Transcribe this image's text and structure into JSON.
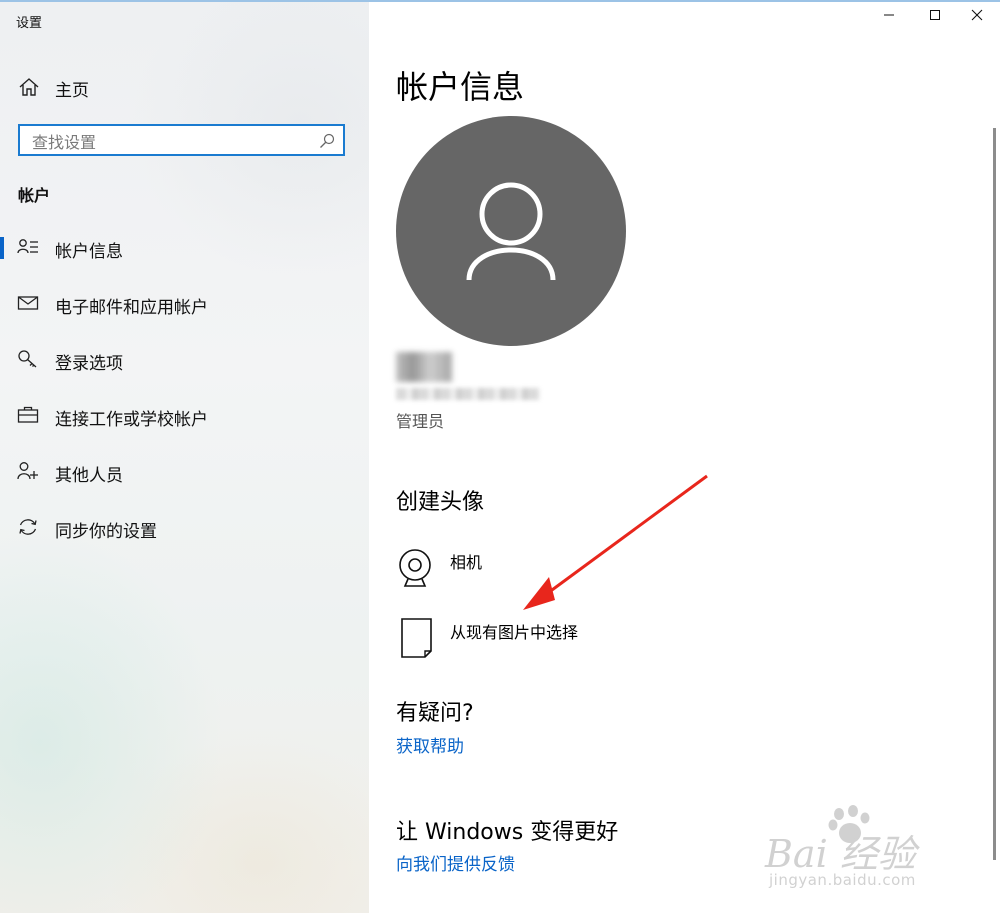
{
  "window": {
    "title": "设置",
    "controls": [
      "minimize",
      "maximize",
      "close"
    ]
  },
  "sidebar": {
    "home_label": "主页",
    "search_placeholder": "查找设置",
    "section_heading": "帐户",
    "items": [
      {
        "label": "帐户信息",
        "icon": "account-info-icon",
        "selected": true
      },
      {
        "label": "电子邮件和应用帐户",
        "icon": "mail-icon",
        "selected": false
      },
      {
        "label": "登录选项",
        "icon": "key-icon",
        "selected": false
      },
      {
        "label": "连接工作或学校帐户",
        "icon": "briefcase-icon",
        "selected": false
      },
      {
        "label": "其他人员",
        "icon": "add-person-icon",
        "selected": false
      },
      {
        "label": "同步你的设置",
        "icon": "sync-icon",
        "selected": false
      }
    ]
  },
  "main": {
    "title": "帐户信息",
    "role": "管理员",
    "create_avatar": {
      "heading": "创建头像",
      "options": [
        {
          "label": "相机",
          "icon": "webcam-icon"
        },
        {
          "label": "从现有图片中选择",
          "icon": "browse-picture-icon"
        }
      ]
    },
    "questions": {
      "heading": "有疑问?",
      "link": "获取帮助"
    },
    "feedback": {
      "heading": "让 Windows 变得更好",
      "link": "向我们提供反馈"
    }
  },
  "watermark": {
    "brand": "Bai 经验",
    "url": "jingyan.baidu.com"
  },
  "colors": {
    "accent": "#0a64c8",
    "avatar_bg": "#666666",
    "arrow": "#e8261c"
  }
}
